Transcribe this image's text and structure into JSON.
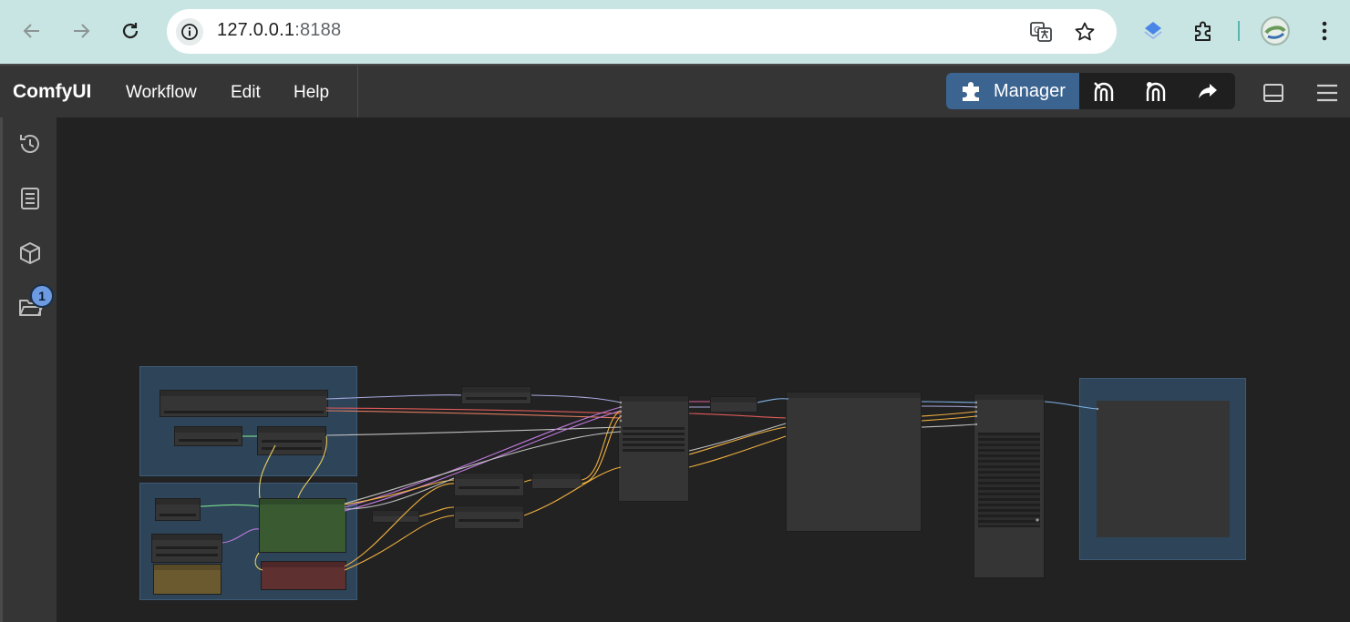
{
  "browser": {
    "url_host": "127.0.0.1",
    "url_port": ":8188",
    "icons": [
      "back-arrow-icon",
      "forward-arrow-icon",
      "reload-icon",
      "site-info-icon",
      "translate-icon",
      "bookmark-star-icon",
      "extension-diamond-icon",
      "extensions-puzzle-icon",
      "profile-avatar",
      "more-vertical-icon"
    ]
  },
  "app": {
    "brand": "ComfyUI",
    "menu": {
      "workflow": "Workflow",
      "edit": "Edit",
      "help": "Help"
    },
    "actions": {
      "manager": "Manager"
    }
  },
  "sidebar": {
    "items": [
      {
        "icon": "history-icon"
      },
      {
        "icon": "book-icon"
      },
      {
        "icon": "cube-icon"
      },
      {
        "icon": "folder-icon"
      }
    ],
    "badge": "1"
  },
  "colors": {
    "accent": "#3b6490",
    "topbar": "#353535",
    "canvas": "#222222",
    "group": "#2d4459",
    "green_node": "#3a5a32",
    "red_node": "#5e3030",
    "yellow_node": "#6b5a30"
  }
}
